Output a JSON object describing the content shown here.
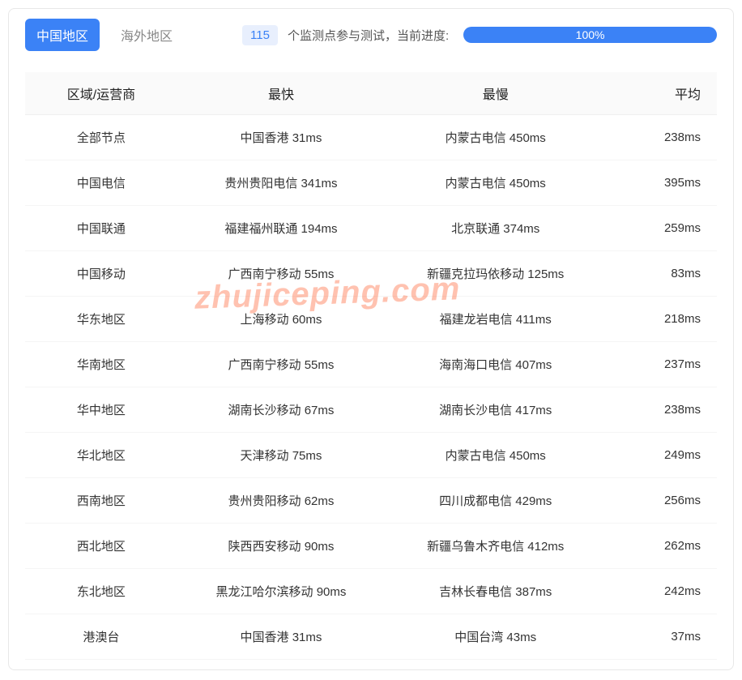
{
  "tabs": {
    "china": "中国地区",
    "overseas": "海外地区"
  },
  "monitor": {
    "count": "115",
    "text": "个监测点参与测试，当前进度:",
    "progress": "100%"
  },
  "table": {
    "headers": {
      "region": "区域/运营商",
      "fastest": "最快",
      "slowest": "最慢",
      "average": "平均"
    },
    "rows": [
      {
        "region": "全部节点",
        "fastest": "中国香港 31ms",
        "slowest": "内蒙古电信 450ms",
        "average": "238ms"
      },
      {
        "region": "中国电信",
        "fastest": "贵州贵阳电信 341ms",
        "slowest": "内蒙古电信 450ms",
        "average": "395ms"
      },
      {
        "region": "中国联通",
        "fastest": "福建福州联通 194ms",
        "slowest": "北京联通 374ms",
        "average": "259ms"
      },
      {
        "region": "中国移动",
        "fastest": "广西南宁移动 55ms",
        "slowest": "新疆克拉玛依移动 125ms",
        "average": "83ms"
      },
      {
        "region": "华东地区",
        "fastest": "上海移动 60ms",
        "slowest": "福建龙岩电信 411ms",
        "average": "218ms"
      },
      {
        "region": "华南地区",
        "fastest": "广西南宁移动 55ms",
        "slowest": "海南海口电信 407ms",
        "average": "237ms"
      },
      {
        "region": "华中地区",
        "fastest": "湖南长沙移动 67ms",
        "slowest": "湖南长沙电信 417ms",
        "average": "238ms"
      },
      {
        "region": "华北地区",
        "fastest": "天津移动 75ms",
        "slowest": "内蒙古电信 450ms",
        "average": "249ms"
      },
      {
        "region": "西南地区",
        "fastest": "贵州贵阳移动 62ms",
        "slowest": "四川成都电信 429ms",
        "average": "256ms"
      },
      {
        "region": "西北地区",
        "fastest": "陕西西安移动 90ms",
        "slowest": "新疆乌鲁木齐电信 412ms",
        "average": "262ms"
      },
      {
        "region": "东北地区",
        "fastest": "黑龙江哈尔滨移动 90ms",
        "slowest": "吉林长春电信 387ms",
        "average": "242ms"
      },
      {
        "region": "港澳台",
        "fastest": "中国香港 31ms",
        "slowest": "中国台湾 43ms",
        "average": "37ms"
      }
    ]
  },
  "watermark": "zhujiceping.com"
}
